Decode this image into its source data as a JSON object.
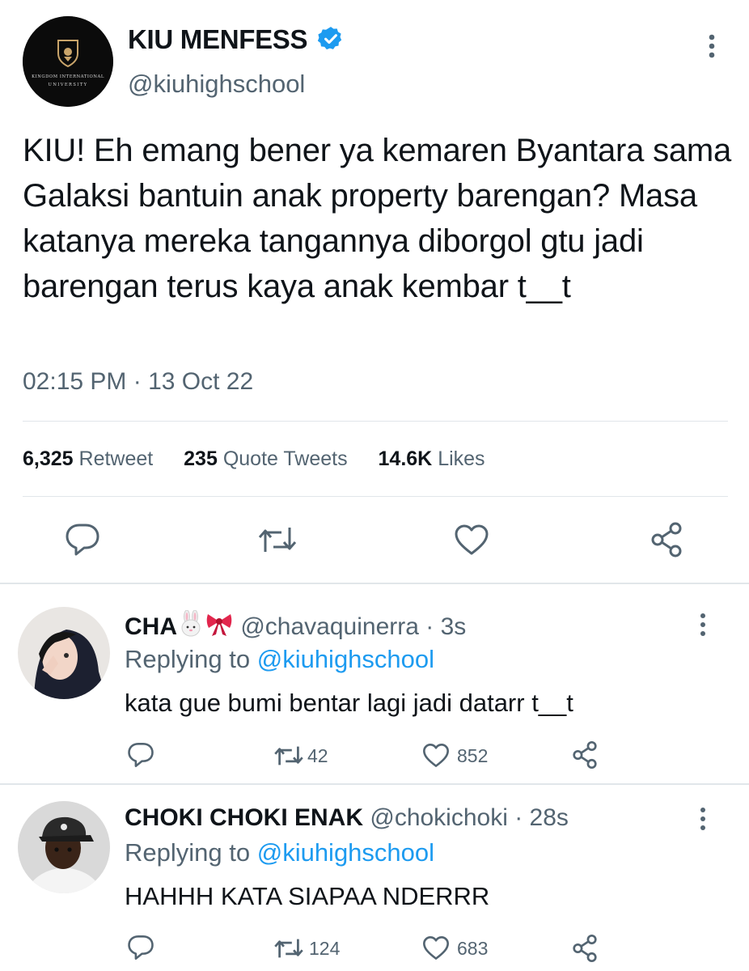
{
  "main_tweet": {
    "author_name": "KIU MENFESS",
    "verified": true,
    "handle": "@kiuhighschool",
    "avatar_text": {
      "line1": "KINGDOM INTERNATIONAL",
      "line2": "UNIVERSITY"
    },
    "text": "KIU! Eh emang bener ya kemaren Byantara sama Galaksi bantuin anak property barengan? Masa katanya mereka tangannya diborgol gtu jadi barengan terus kaya anak kembar t__t",
    "timestamp": "02:15 PM · 13 Oct 22",
    "stats": {
      "retweets": "6,325",
      "retweets_label": "Retweet",
      "quotes": "235",
      "quotes_label": "Quote Tweets",
      "likes": "14.6K",
      "likes_label": "Likes"
    },
    "actions": [
      "reply-icon",
      "retweet-icon",
      "like-icon",
      "share-icon"
    ]
  },
  "replies": [
    {
      "name": "CHA",
      "emojis": [
        "rabbit-emoji",
        "ribbon-emoji"
      ],
      "handle": "@chavaquinerra",
      "time": "· 3s",
      "replying_prefix": "Replying to",
      "replying_to": "@kiuhighschool",
      "text": "kata gue bumi bentar lagi jadi datarr t__t",
      "retweets": "42",
      "likes": "852"
    },
    {
      "name": "CHOKI CHOKI ENAK",
      "emojis": [],
      "handle": "@chokichoki",
      "time": "· 28s",
      "replying_prefix": "Replying to",
      "replying_to": "@kiuhighschool",
      "text": "HAHHH KATA SIAPAA NDERRR",
      "retweets": "124",
      "likes": "683"
    }
  ],
  "colors": {
    "text_primary": "#0f1419",
    "text_secondary": "#536471",
    "link_blue": "#1d9bf0",
    "divider": "#e1e6ea",
    "icon_gray": "#536471"
  }
}
